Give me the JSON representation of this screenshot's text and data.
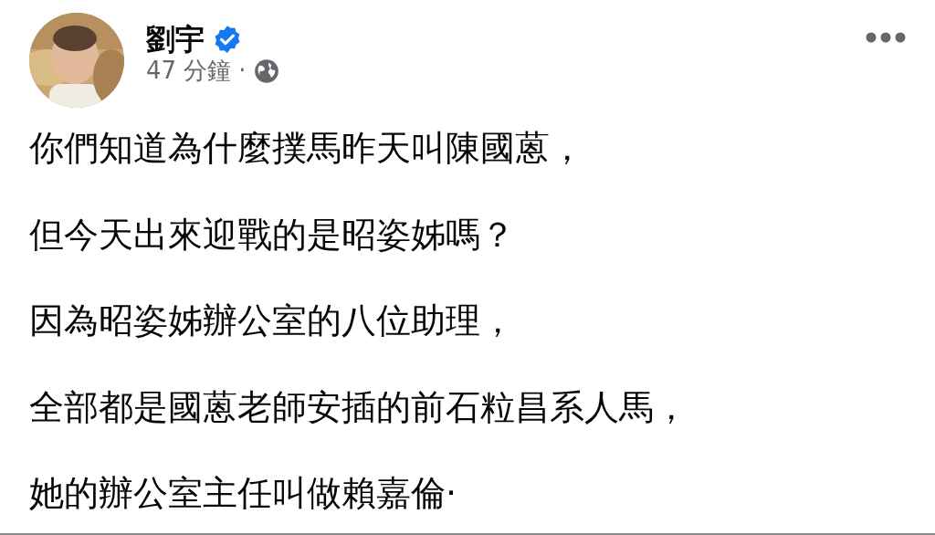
{
  "post": {
    "author": {
      "name": "劉宇",
      "verified": true
    },
    "time": "47 分鐘",
    "separator": "·",
    "public": true,
    "paragraphs": [
      "你們知道為什麼撲馬昨天叫陳國蒽，",
      "但今天出來迎戰的是昭姿姊嗎？",
      "因為昭姿姊辦公室的八位助理，",
      "全部都是國蒽老師安插的前石粒昌系人馬，",
      "她的辦公室主任叫做賴嘉倫·"
    ]
  }
}
